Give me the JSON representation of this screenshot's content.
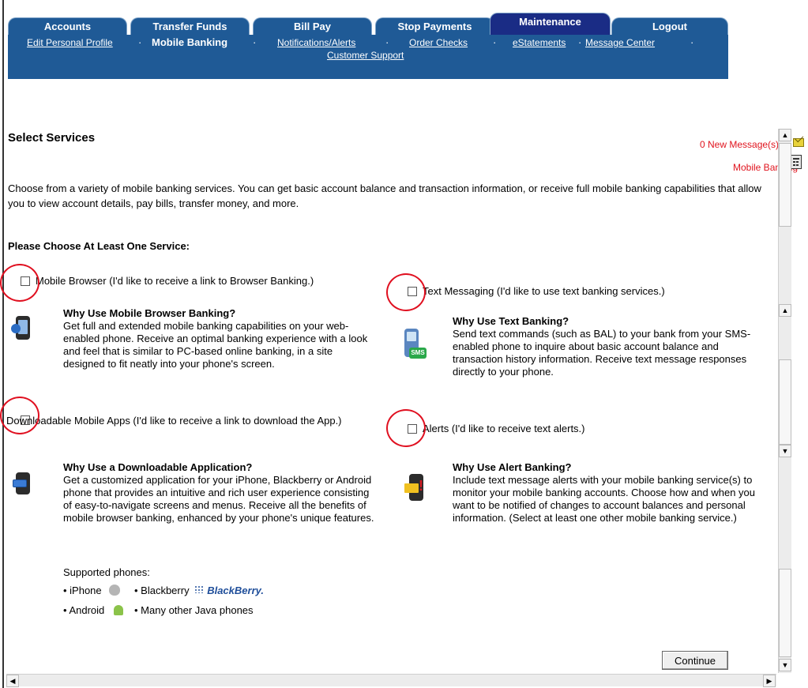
{
  "tabs": [
    {
      "label": "Accounts"
    },
    {
      "label": "Transfer Funds"
    },
    {
      "label": "Bill Pay"
    },
    {
      "label": "Stop Payments"
    },
    {
      "label": "Maintenance"
    },
    {
      "label": "Logout"
    }
  ],
  "active_tab": "Maintenance",
  "subnav": {
    "edit_profile": "Edit Personal Profile",
    "mobile_banking": "Mobile Banking",
    "notifications": "Notifications/Alerts",
    "order_checks": "Order Checks",
    "estatements": "eStatements",
    "message_center": "Message Center",
    "customer_support": "Customer Support",
    "separator": "·"
  },
  "header_links": {
    "new_messages": "0 New Message(s)",
    "mobile_banking": "Mobile Banking"
  },
  "page": {
    "title": "Select Services",
    "intro": "Choose from a variety of mobile banking services. You can get basic account balance and transaction information, or receive full mobile banking capabilities that allow you to view account details, pay bills, transfer money, and more.",
    "choose_prompt": "Please Choose At Least One Service:"
  },
  "services": {
    "browser": {
      "label": "Mobile Browser (I'd like to receive a link to Browser Banking.)",
      "why_title": "Why Use Mobile Browser Banking?",
      "why_body": "Get full and extended mobile banking capabilities on your web-enabled phone. Receive an optimal banking experience with a look and feel that is similar to PC-based online banking, in a site designed to fit neatly into your phone's screen.",
      "checked": false
    },
    "text": {
      "label": "Text Messaging (I'd like to use text banking services.)",
      "why_title": "Why Use Text Banking?",
      "why_body": "Send text commands (such as BAL) to your bank from your SMS-enabled phone to inquire about basic account balance and transaction history information. Receive text message responses directly to your phone.",
      "icon_text": "SMS",
      "checked": false
    },
    "apps": {
      "label": "Downloadable Mobile Apps (I'd like to receive a link to download the App.)",
      "why_title": "Why Use a Downloadable Application?",
      "why_body": "Get a customized application for your iPhone, Blackberry or Android phone that provides an intuitive and rich user experience consisting of easy-to-navigate screens and menus. Receive all the benefits of mobile browser banking, enhanced by your phone's unique features.",
      "checked": false
    },
    "alerts": {
      "label": "Alerts (I'd like to receive text alerts.)",
      "why_title": "Why Use Alert Banking?",
      "why_body": "Include text message alerts with your mobile banking service(s) to monitor your mobile banking accounts. Choose how and when you want to be notified of changes to account balances and personal information. (Select at least one other mobile banking service.)",
      "checked": false
    }
  },
  "supported_phones": {
    "heading": "Supported phones:",
    "iphone": "• iPhone",
    "blackberry": "• Blackberry",
    "blackberry_logo": "BlackBerry.",
    "android": "• Android",
    "java": "• Many other Java phones"
  },
  "continue_label": "Continue",
  "colors": {
    "tab_bg": "#1f5a96",
    "tab_active_bg": "#1a2c85",
    "link_red": "#e0141e",
    "annotation_ring": "#e01020"
  }
}
